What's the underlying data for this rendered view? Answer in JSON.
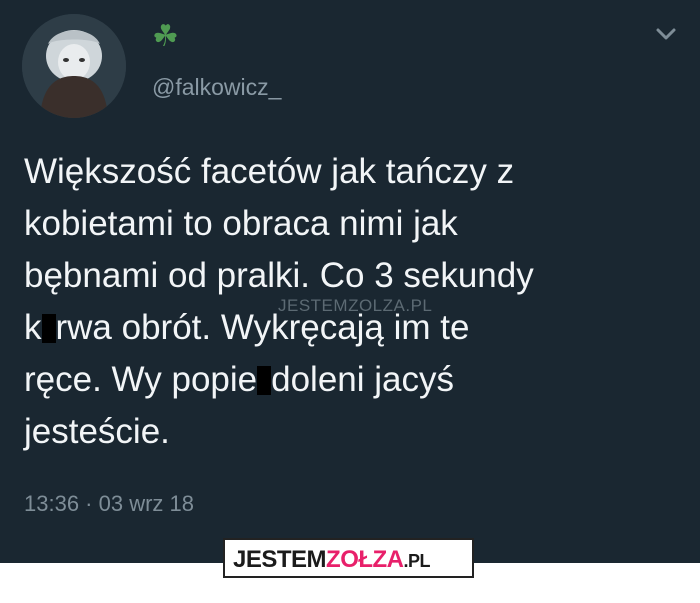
{
  "tweet": {
    "handle": "@falkowicz_",
    "lines": [
      {
        "before": "Większość facetów jak tańczy z"
      },
      {
        "before": "kobietami to obraca nimi jak"
      },
      {
        "before": "bębnami od pralki. Co 3 sekundy"
      },
      {
        "before": "k",
        "after": "rwa obrót. Wykręcają im te"
      },
      {
        "before": "ręce. Wy popie",
        "after": "doleni jacyś"
      },
      {
        "before": "jesteście."
      }
    ],
    "timestamp": "13:36 · 03 wrz 18"
  },
  "watermark_inline": {
    "part1": "JESTEM",
    "part2": "ZOLZA",
    "part3": ".PL"
  },
  "badge": {
    "part1": "JESTEM",
    "part2": "ZOŁZA",
    "part3": ".PL"
  },
  "colors": {
    "background": "#1a2731",
    "text": "#f2f5f7",
    "muted": "#8a9aa5",
    "brand_pink": "#e8206a"
  },
  "icons": [
    "avatar",
    "clover-icon",
    "chevron-down-icon"
  ]
}
